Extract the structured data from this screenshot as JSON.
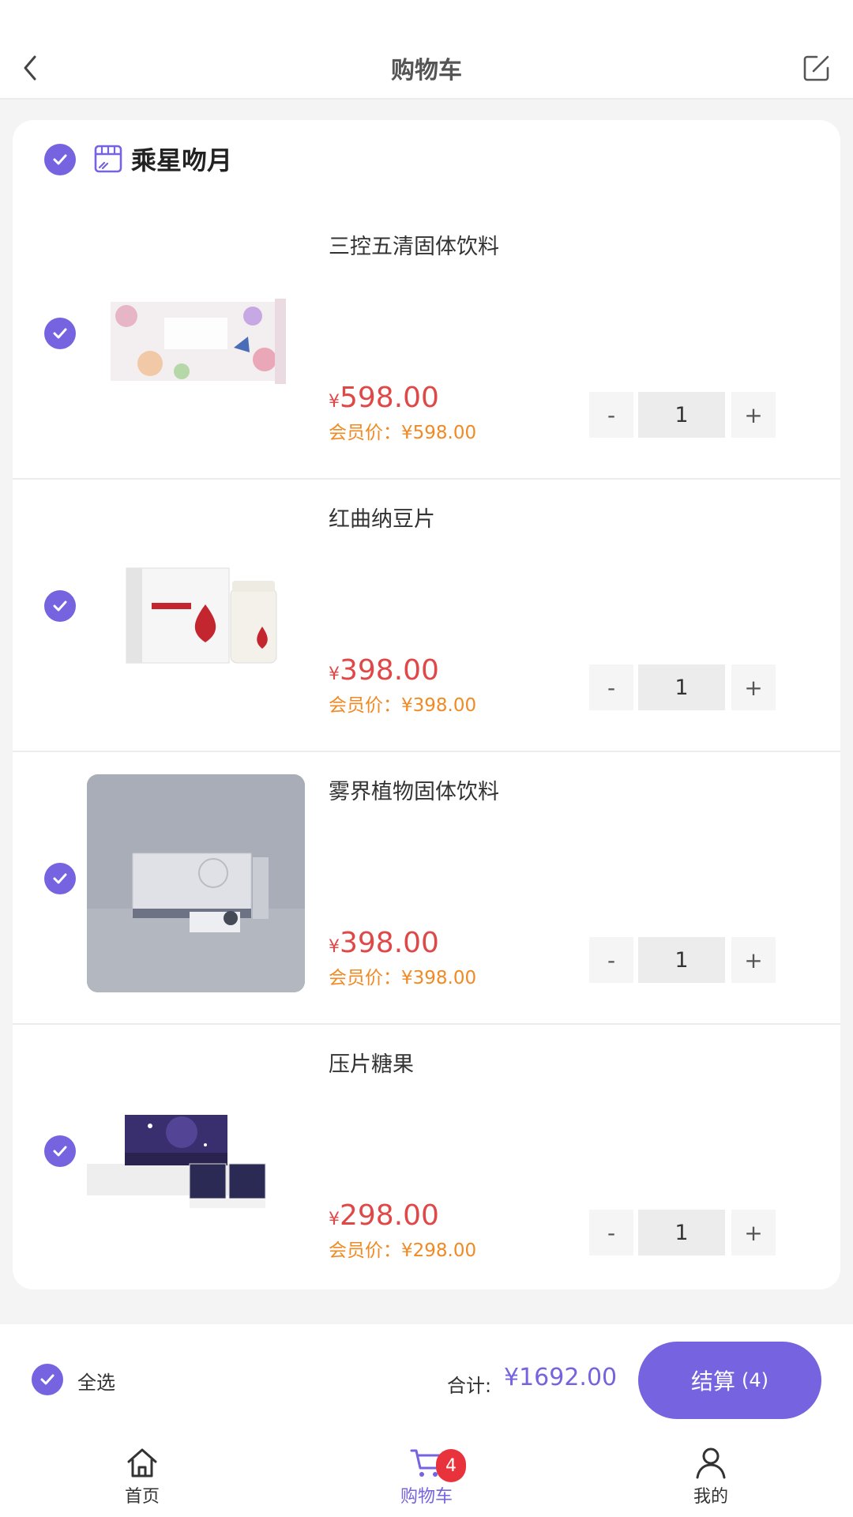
{
  "header": {
    "title": "购物车"
  },
  "store": {
    "name": "乘星吻月"
  },
  "items": [
    {
      "name": "三控五清固体饮料",
      "yen": "¥",
      "price": "598.00",
      "member_price": "会员价：¥598.00",
      "qty": "1"
    },
    {
      "name": "红曲纳豆片",
      "yen": "¥",
      "price": "398.00",
      "member_price": "会员价：¥398.00",
      "qty": "1"
    },
    {
      "name": "雾界植物固体饮料",
      "yen": "¥",
      "price": "398.00",
      "member_price": "会员价：¥398.00",
      "qty": "1"
    },
    {
      "name": "压片糖果",
      "yen": "¥",
      "price": "298.00",
      "member_price": "会员价：¥298.00",
      "qty": "1"
    }
  ],
  "stepper": {
    "minus": "-",
    "plus": "+"
  },
  "checkout": {
    "select_all": "全选",
    "total_label": "合计:",
    "total_value": "¥1692.00",
    "button_label": "结算",
    "button_count": "(4)"
  },
  "tabbar": {
    "tabs": [
      {
        "label": "首页",
        "icon": "home-icon"
      },
      {
        "label": "购物车",
        "icon": "cart-icon",
        "badge": "4"
      },
      {
        "label": "我的",
        "icon": "user-icon"
      }
    ]
  },
  "colors": {
    "accent": "#7563e0",
    "price": "#e04848",
    "member_price": "#f08a24",
    "badge": "#e8333c"
  }
}
